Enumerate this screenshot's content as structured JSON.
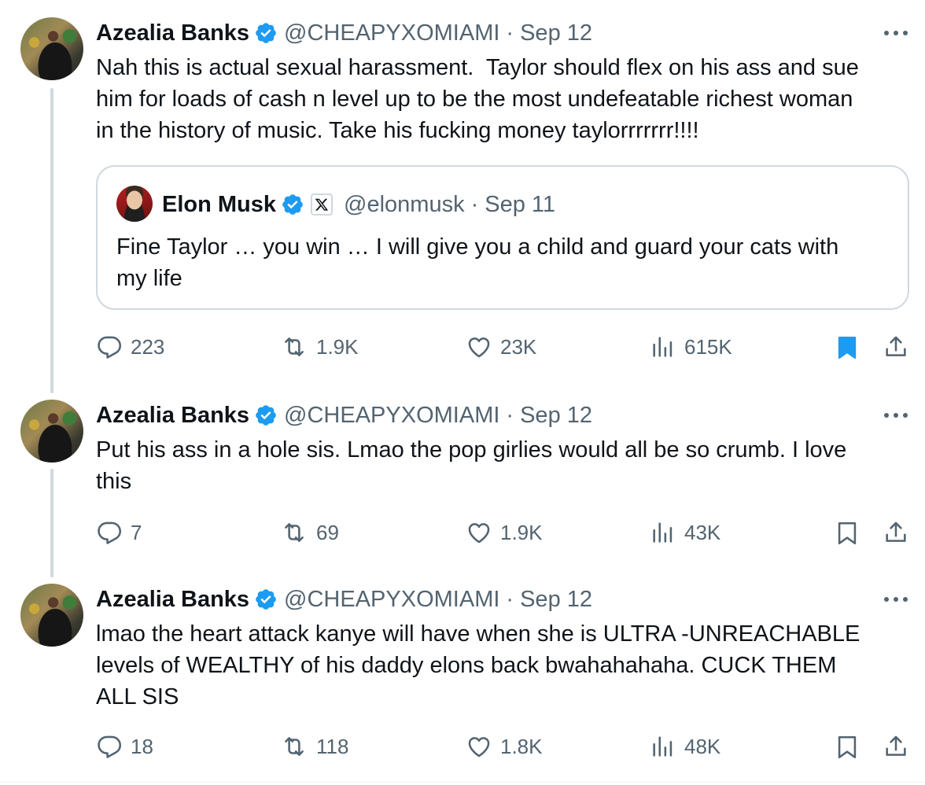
{
  "tweets": [
    {
      "name": "Azealia Banks",
      "handle": "@CHEAPYXOMIAMI",
      "separator": "·",
      "date": "Sep 12",
      "text": "Nah this is actual sexual harassment.  Taylor should flex on his ass and sue\nhim for loads of cash n level up to be the most undefeatable richest woman\nin the history of music. Take his fucking money taylorrrrrrr!!!!",
      "quote": {
        "name": "Elon Musk",
        "handle": "@elonmusk",
        "separator": "·",
        "date": "Sep 11",
        "text": "Fine Taylor … you win … I will give you a child and guard your cats with\nmy life"
      },
      "stats": {
        "replies": "223",
        "reposts": "1.9K",
        "likes": "23K",
        "views": "615K"
      },
      "bookmarked": true
    },
    {
      "name": "Azealia Banks",
      "handle": "@CHEAPYXOMIAMI",
      "separator": "·",
      "date": "Sep 12",
      "text": "Put his ass in a hole sis. Lmao the pop girlies would all be so crumb. I love\nthis",
      "stats": {
        "replies": "7",
        "reposts": "69",
        "likes": "1.9K",
        "views": "43K"
      },
      "bookmarked": false
    },
    {
      "name": "Azealia Banks",
      "handle": "@CHEAPYXOMIAMI",
      "separator": "·",
      "date": "Sep 12",
      "text": "lmao the heart attack kanye will have when she is ULTRA -UNREACHABLE\nlevels of WEALTHY of his daddy elons back bwahahahaha. CUCK THEM\nALL SIS",
      "stats": {
        "replies": "18",
        "reposts": "118",
        "likes": "1.8K",
        "views": "48K"
      },
      "bookmarked": false
    }
  ],
  "colors": {
    "accent": "#1d9bf0",
    "muted": "#536471",
    "text": "#0f1419",
    "border": "#cfd9de"
  },
  "icons": [
    "verified-badge-icon",
    "more-icon",
    "reply-icon",
    "repost-icon",
    "like-icon",
    "views-icon",
    "bookmark-icon",
    "share-icon",
    "x-logo-icon"
  ]
}
